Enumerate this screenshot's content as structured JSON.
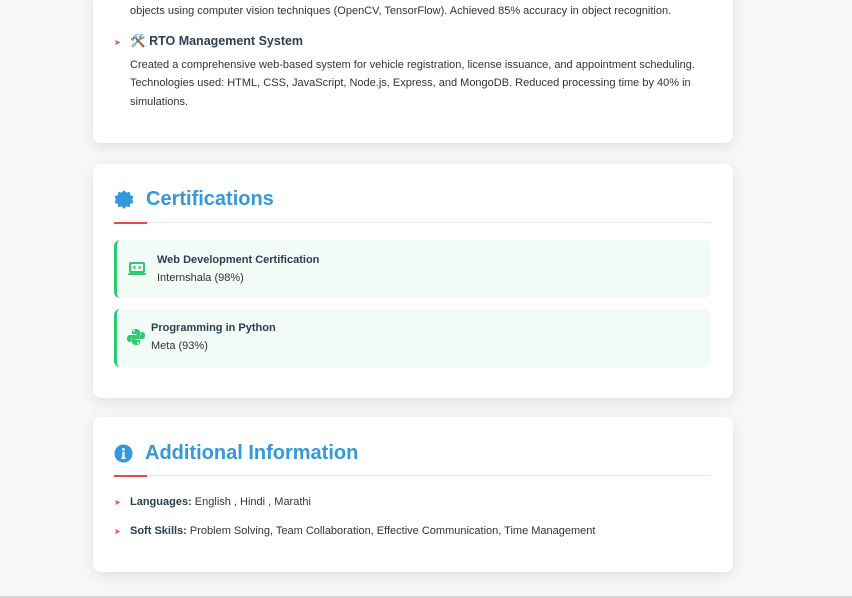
{
  "projects": {
    "prev_desc_tail": "objects using computer vision techniques (OpenCV, TensorFlow). Achieved 85% accuracy in object recognition.",
    "item_emoji": "🛠️",
    "item_title": "RTO Management System",
    "item_desc_line1": "Created a comprehensive web-based system for vehicle registration, license issuance, and appointment scheduling.",
    "item_desc_line2": "Technologies used: HTML, CSS, JavaScript, Node.js, Express, and MongoDB. Reduced processing time by 40% in",
    "item_desc_line3": "simulations."
  },
  "certifications": {
    "title": "Certifications",
    "icon": "certificate-badge-icon",
    "items": [
      {
        "name": "Web Development Certification",
        "issuer": "Internshala (98%)",
        "icon": "laptop-code-icon"
      },
      {
        "name": "Programming in Python",
        "issuer": "Meta (93%)",
        "icon": "python-icon"
      }
    ]
  },
  "additional": {
    "title": "Additional Information",
    "icon": "info-circle-icon",
    "languages_label": "Languages:",
    "languages_value": "English , Hindi , Marathi",
    "soft_skills_label": "Soft Skills:",
    "soft_skills_value": "Problem Solving, Team Collaboration, Effective Communication, Time Management"
  },
  "colors": {
    "accent_blue": "#3498db",
    "accent_red": "#e74c3c",
    "accent_green": "#2ecc71"
  }
}
